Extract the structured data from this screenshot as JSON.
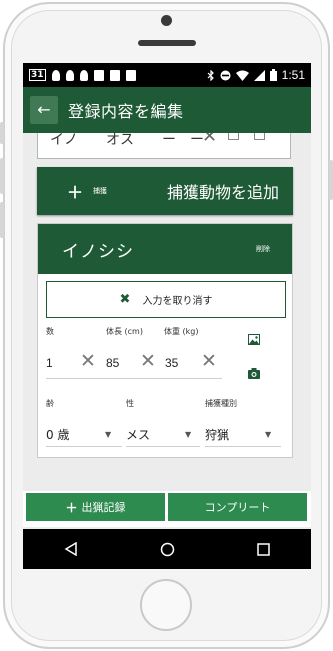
{
  "status_bar": {
    "date_badge": "31",
    "time": "1:51"
  },
  "app_bar": {
    "back_icon": "arrow-back-icon",
    "title": "登録内容を編集"
  },
  "previous_card": {
    "cut_text": "イノ　　オス　　ー　ー"
  },
  "add_animal_button": {
    "plus": "＋",
    "small_label": "捕獲",
    "label": "捕獲動物を追加"
  },
  "animal_card": {
    "name": "イノシシ",
    "delete_label": "削除",
    "cancel_button": {
      "icon": "close-icon",
      "label": "入力を取り消す"
    },
    "fields": {
      "count": {
        "label": "数",
        "value": "1"
      },
      "length": {
        "label": "体長 (cm)",
        "value": "85"
      },
      "weight": {
        "label": "体重 (kg)",
        "value": "35"
      }
    },
    "dropdowns": {
      "age": {
        "label": "齢",
        "value": "0 歳"
      },
      "sex": {
        "label": "性",
        "value": "メス"
      },
      "method": {
        "label": "捕獲種別",
        "value": "狩猟"
      }
    }
  },
  "bottom_actions": {
    "hunting_record": "出猟記録",
    "complete": "コンプリート",
    "plus": "＋"
  },
  "colors": {
    "primary": "#1f5a36",
    "button": "#2e8b4f"
  }
}
